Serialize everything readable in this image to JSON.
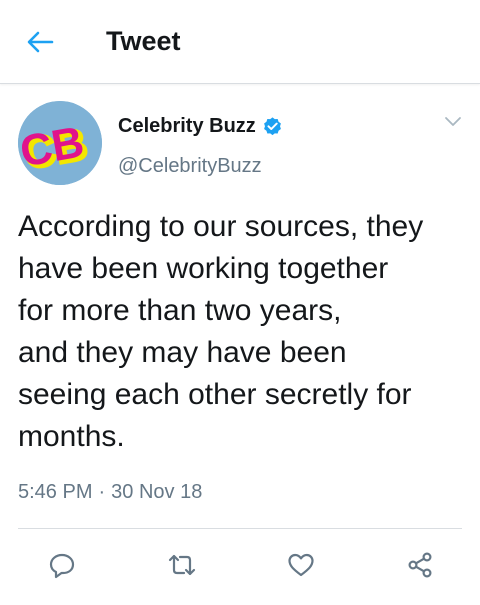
{
  "header": {
    "title": "Tweet",
    "back_icon": "arrow-left-icon"
  },
  "colors": {
    "accent": "#1da1f2",
    "text": "#14171a",
    "muted": "#657786",
    "divider": "#d9dde1",
    "avatar_bg": "#7fb2d6",
    "avatar_logo": "#e0138c",
    "avatar_logo_shadow": "#f3e600"
  },
  "tweet": {
    "author": {
      "name": "Celebrity Buzz",
      "handle": "@CelebrityBuzz",
      "verified": true,
      "avatar_text": "CB"
    },
    "text_lines": [
      "According to our sources, they",
      "have been working together",
      "for more than two years,",
      "and they may have been",
      "seeing each other secretly for",
      "months."
    ],
    "time": "5:46 PM",
    "separator": "·",
    "date": "30 Nov 18"
  },
  "actions": [
    {
      "name": "reply",
      "icon": "reply-icon"
    },
    {
      "name": "retweet",
      "icon": "retweet-icon"
    },
    {
      "name": "like",
      "icon": "heart-icon"
    },
    {
      "name": "share",
      "icon": "share-icon"
    }
  ]
}
